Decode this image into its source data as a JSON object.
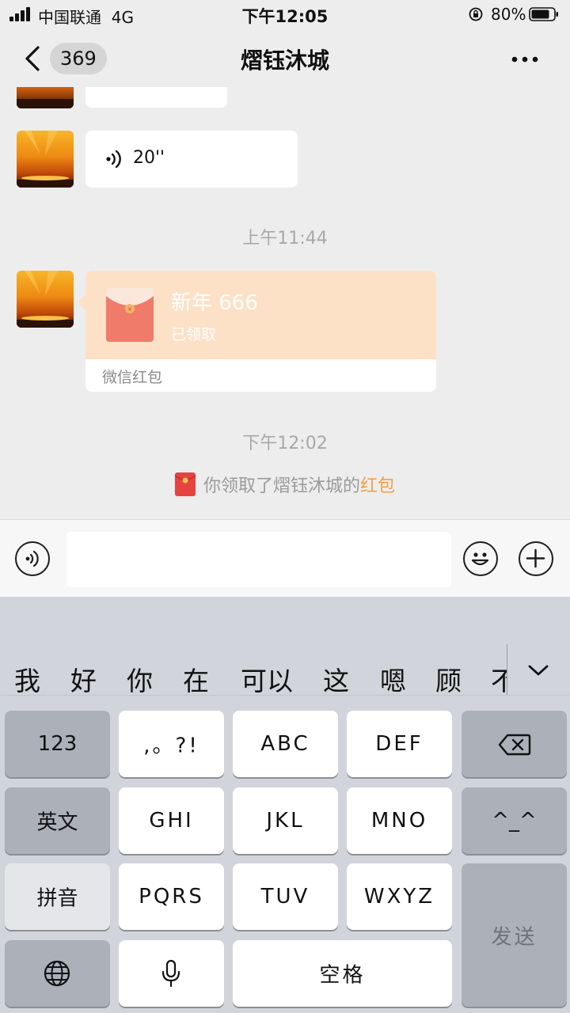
{
  "status_bar": {
    "carrier": "中国联通",
    "network": "4G",
    "time": "下午12:05",
    "battery": "80%"
  },
  "nav": {
    "unread_count": "369",
    "title": "熠钰沐城"
  },
  "messages": {
    "voice_duration": "20''",
    "time_1": "上午11:44",
    "red_packet": {
      "title": "新年 666",
      "status": "已领取",
      "label": "微信红包"
    },
    "time_2": "下午12:02",
    "notice_prefix": "你领取了熠钰沐城的",
    "notice_link": "红包"
  },
  "input": {
    "value": ""
  },
  "keyboard": {
    "candidates": [
      "我",
      "好",
      "你",
      "在",
      "可以",
      "这",
      "嗯",
      "顾",
      "不"
    ],
    "keys": {
      "num": "123",
      "punct": ",。?!",
      "abc": "ABC",
      "def": "DEF",
      "english": "英文",
      "ghi": "GHI",
      "jkl": "JKL",
      "mno": "MNO",
      "emoticon": "^_^",
      "pinyin": "拼音",
      "pqrs": "PQRS",
      "tuv": "TUV",
      "wxyz": "WXYZ",
      "send": "发送",
      "space": "空格"
    }
  },
  "colors": {
    "background": "#ededed",
    "red_packet_bg": "#fde1c6",
    "red_packet_icon": "#f07b6a",
    "link_orange": "#f0a046"
  },
  "icons": [
    "signal-icon",
    "battery-icon",
    "back-icon",
    "more-icon",
    "voice-icon",
    "emoji-icon",
    "plus-icon",
    "delete-icon",
    "globe-icon",
    "mic-icon",
    "chevron-down-icon",
    "red-packet-icon"
  ]
}
